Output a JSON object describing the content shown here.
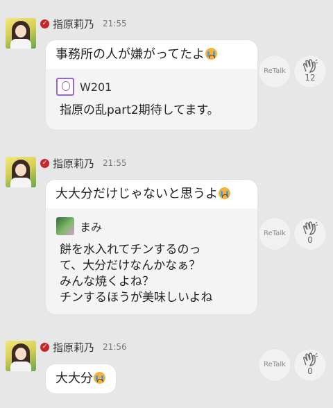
{
  "messages": [
    {
      "name": "指原莉乃",
      "time": "21:55",
      "text": "事務所の人が嫌がってたよ",
      "reply_user": "W201",
      "reply_text": "指原の乱part2期待してます。",
      "retalk": "ReTalk",
      "claps": "12"
    },
    {
      "name": "指原莉乃",
      "time": "21:55",
      "text": "大大分だけじゃないと思うよ",
      "reply_user": "まみ",
      "reply_text": "餅を水入れてチンするのっ\nて、大分だけなんかなぁ？\nみんな焼くよね？\nチンするほうが美味しいよね",
      "retalk": "ReTalk",
      "claps": "0"
    },
    {
      "name": "指原莉乃",
      "time": "21:56",
      "text": "大大分",
      "retalk": "ReTalk",
      "claps": "0"
    }
  ],
  "icons": {
    "badge": "check-badge-icon",
    "emoji": "crying-face-emoji",
    "clap": "clap-hands-icon"
  },
  "colors": {
    "badge": "#c4262a",
    "background": "#e7e7e7"
  }
}
